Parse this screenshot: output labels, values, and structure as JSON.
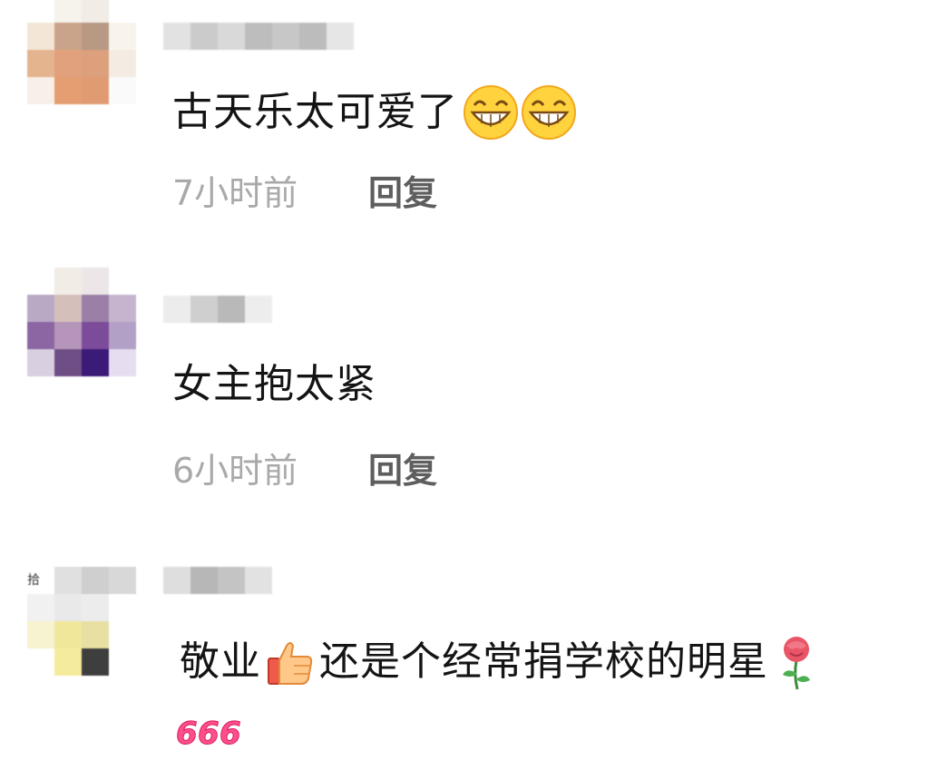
{
  "comments": [
    {
      "text": "古天乐太可爱了",
      "emojis": [
        "grinning-face",
        "grinning-face"
      ],
      "time": "7小时前",
      "reply_label": "回复"
    },
    {
      "text": "女主抱太紧",
      "time": "6小时前",
      "reply_label": "回复"
    },
    {
      "text_before": "敬业",
      "text_after": "还是个经常捐学校的明星",
      "emojis": [
        "thumbs-up",
        "rose",
        "666"
      ]
    }
  ],
  "avatar3_fragment": "拾"
}
